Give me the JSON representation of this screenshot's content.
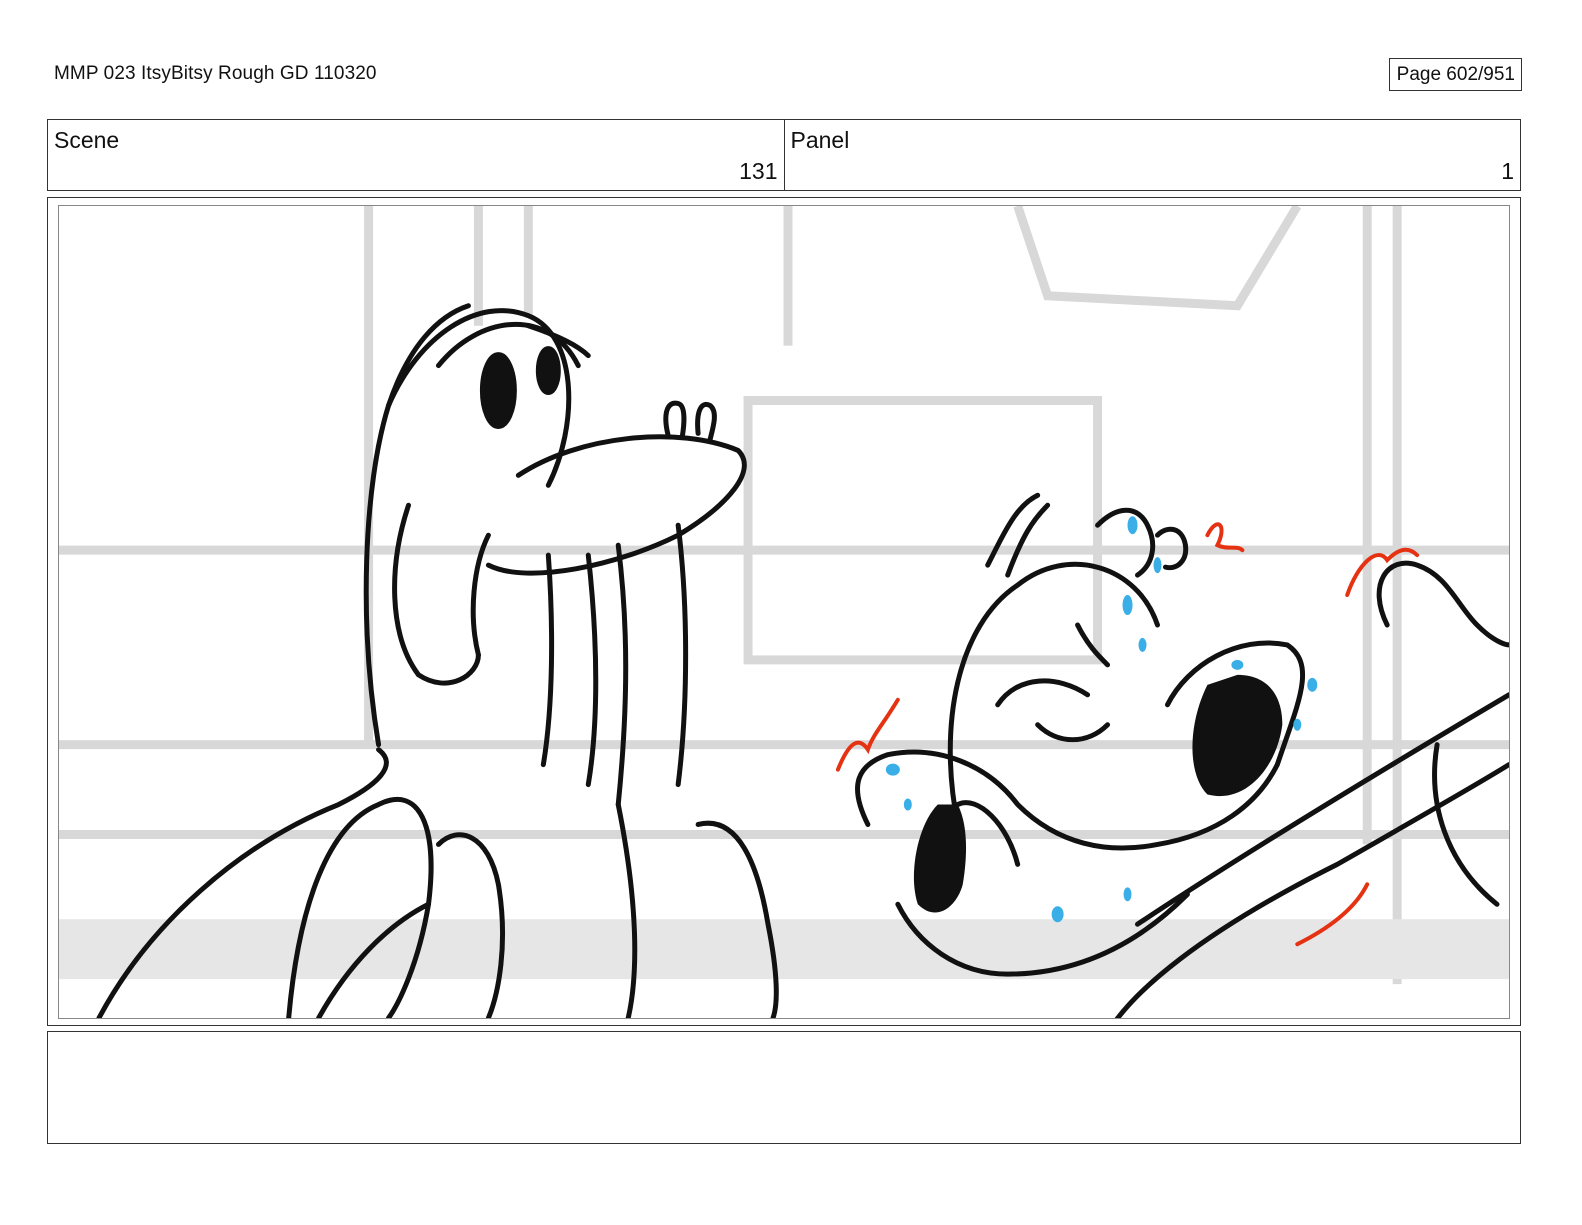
{
  "header": {
    "document_title": "MMP 023 ItsyBitsy Rough GD 110320",
    "page_label": "Page 602/951"
  },
  "scene": {
    "label": "Scene",
    "value": "131"
  },
  "panel": {
    "label": "Panel",
    "value": "1"
  },
  "notes": {
    "text": ""
  }
}
